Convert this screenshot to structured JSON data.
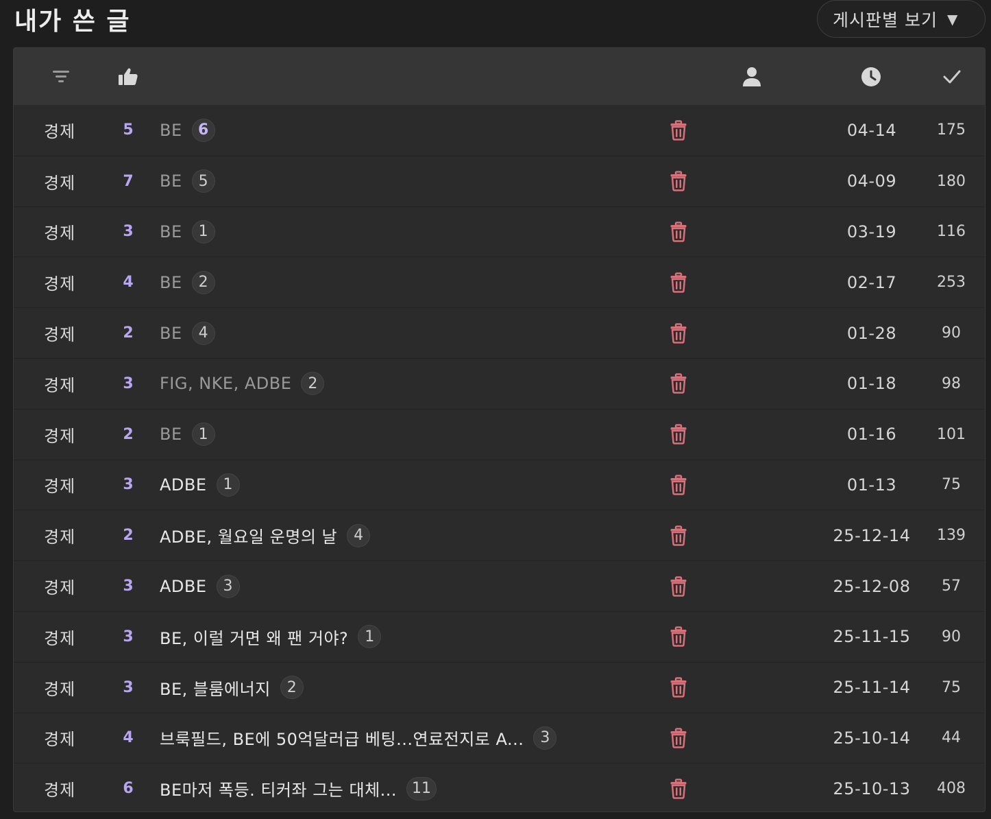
{
  "header": {
    "page_title": "내가 쓴 글",
    "board_select_label": "게시판별 보기",
    "caret_glyph": "▼"
  },
  "table": {
    "header_icons": [
      "filter-icon",
      "thumbs-up-icon",
      "user-icon",
      "clock-icon",
      "check-icon"
    ],
    "rows": [
      {
        "category": "경제",
        "likes": "5",
        "title": "BE",
        "comments": "6",
        "comments_hot": true,
        "read": true,
        "date": "04-14",
        "views": "175"
      },
      {
        "category": "경제",
        "likes": "7",
        "title": "BE",
        "comments": "5",
        "comments_hot": false,
        "read": true,
        "date": "04-09",
        "views": "180"
      },
      {
        "category": "경제",
        "likes": "3",
        "title": "BE",
        "comments": "1",
        "comments_hot": false,
        "read": true,
        "date": "03-19",
        "views": "116"
      },
      {
        "category": "경제",
        "likes": "4",
        "title": "BE",
        "comments": "2",
        "comments_hot": false,
        "read": true,
        "date": "02-17",
        "views": "253"
      },
      {
        "category": "경제",
        "likes": "2",
        "title": "BE",
        "comments": "4",
        "comments_hot": false,
        "read": true,
        "date": "01-28",
        "views": "90"
      },
      {
        "category": "경제",
        "likes": "3",
        "title": "FIG, NKE, ADBE",
        "comments": "2",
        "comments_hot": false,
        "read": true,
        "date": "01-18",
        "views": "98"
      },
      {
        "category": "경제",
        "likes": "2",
        "title": "BE",
        "comments": "1",
        "comments_hot": false,
        "read": true,
        "date": "01-16",
        "views": "101"
      },
      {
        "category": "경제",
        "likes": "3",
        "title": "ADBE",
        "comments": "1",
        "comments_hot": false,
        "read": false,
        "date": "01-13",
        "views": "75"
      },
      {
        "category": "경제",
        "likes": "2",
        "title": "ADBE, 월요일 운명의 날",
        "comments": "4",
        "comments_hot": false,
        "read": false,
        "date": "25-12-14",
        "views": "139"
      },
      {
        "category": "경제",
        "likes": "3",
        "title": "ADBE",
        "comments": "3",
        "comments_hot": false,
        "read": false,
        "date": "25-12-08",
        "views": "57"
      },
      {
        "category": "경제",
        "likes": "3",
        "title": "BE, 이럴 거면 왜 팬 거야?",
        "comments": "1",
        "comments_hot": false,
        "read": false,
        "date": "25-11-15",
        "views": "90"
      },
      {
        "category": "경제",
        "likes": "3",
        "title": "BE, 블룸에너지",
        "comments": "2",
        "comments_hot": false,
        "read": false,
        "date": "25-11-14",
        "views": "75"
      },
      {
        "category": "경제",
        "likes": "4",
        "title": "브룩필드, BE에 50억달러급 베팅...연료전지로 A...",
        "comments": "3",
        "comments_hot": false,
        "read": false,
        "date": "25-10-14",
        "views": "44"
      },
      {
        "category": "경제",
        "likes": "6",
        "title": "BE마저 폭등. 티커좌 그는 대체...",
        "comments": "11",
        "comments_hot": false,
        "read": false,
        "date": "25-10-13",
        "views": "408"
      }
    ]
  },
  "colors": {
    "background": "#1e1e1e",
    "table_bg": "#2b2b2b",
    "header_bg": "#363636",
    "likes_accent": "#b8a6f0",
    "delete_red": "#d9707a"
  }
}
